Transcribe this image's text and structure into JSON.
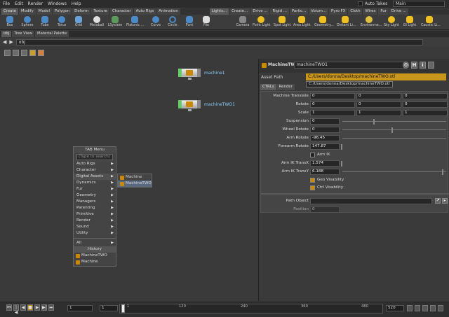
{
  "menubar": {
    "items": [
      "File",
      "Edit",
      "Render",
      "Windows",
      "Help"
    ],
    "auto_takes": "Auto Takes",
    "desktop": "Main"
  },
  "shelf_tabs": {
    "left": [
      "Create",
      "Modify",
      "Model",
      "Polygon",
      "Deform",
      "Texture",
      "Character",
      "Auto Rigs",
      "Animation"
    ],
    "right": [
      "Lights...",
      "Create...",
      "Drive ...",
      "Rigid ...",
      "Partic...",
      "Volum...",
      "Pyro FX",
      "Cloth",
      "Wires",
      "Fur",
      "Drive ..."
    ]
  },
  "shelf_tools": {
    "left": [
      "Box",
      "Sphere",
      "Tube",
      "Torus",
      "Grid",
      "Metaball",
      "LSystem",
      "Platonic ...",
      "Curve",
      "Circle",
      "Font",
      "File"
    ],
    "right": [
      "Camera",
      "Point Light",
      "Spot Light",
      "Area Light",
      "Geometry...",
      "Distant Li...",
      "Environme...",
      "Sky Light",
      "GI Light",
      "Caustic Li..."
    ]
  },
  "pane_tabs": [
    "obj",
    "Tree View",
    "Material Palette"
  ],
  "path": "obj",
  "nodes": [
    {
      "name": "machine1"
    },
    {
      "name": "machineTWO1"
    }
  ],
  "tab_menu": {
    "title": "TAB Menu",
    "search_placeholder": "(Type to search)",
    "items": [
      "Auto Rigs",
      "Character",
      "Digital Assets",
      "Dynamics",
      "Fur",
      "Geometry",
      "Managers",
      "Parenting",
      "Primitive",
      "Render",
      "Sound",
      "Utility"
    ],
    "all": "All",
    "history_label": "History",
    "history": [
      "MachineTWO",
      "Machine"
    ]
  },
  "submenu": [
    "Machine",
    "MachineTWO"
  ],
  "params": {
    "node_type": "MachineTWO",
    "node_name": "machineTWO1",
    "asset_path_label": "Asset Path",
    "asset_path": "C:/Users/donna/Desktop/machineTWO.otl",
    "asset_tooltip": "C:/Users/donna/Desktop/machineTWO.otl",
    "tabs": [
      "CTRLs",
      "Render"
    ],
    "machine_translate": {
      "label": "Machine Translate",
      "values": [
        "0",
        "0",
        "0"
      ]
    },
    "rotate": {
      "label": "Rotate",
      "values": [
        "0",
        "0",
        "0"
      ]
    },
    "scale": {
      "label": "Scale",
      "values": [
        "1",
        "1",
        "1"
      ]
    },
    "suspension": {
      "label": "Suspension",
      "value": "0"
    },
    "wheel_rotate": {
      "label": "Wheel Rotate",
      "value": "0"
    },
    "arm_rotate": {
      "label": "Arm Rotate",
      "value": "-96.45"
    },
    "forearm_rotate": {
      "label": "Forearm Rotate",
      "value": "147.87"
    },
    "arm_ik": {
      "label": "Arm IK"
    },
    "arm_ik_transx": {
      "label": "Arm IK TransX",
      "value": "1.574"
    },
    "arm_ik_transy": {
      "label": "Arm IK TransY",
      "value": "6.188"
    },
    "geo_visability": {
      "label": "Geo Visability"
    },
    "ctrl_visability": {
      "label": "Ctrl Visability"
    },
    "path_object": {
      "label": "Path Object",
      "value": ""
    },
    "position": {
      "label": "Position",
      "value": "0"
    }
  },
  "timeline": {
    "frame": "1",
    "start": "1",
    "ticks": [
      "1",
      "120",
      "240",
      "360",
      "480"
    ],
    "end": "520"
  }
}
